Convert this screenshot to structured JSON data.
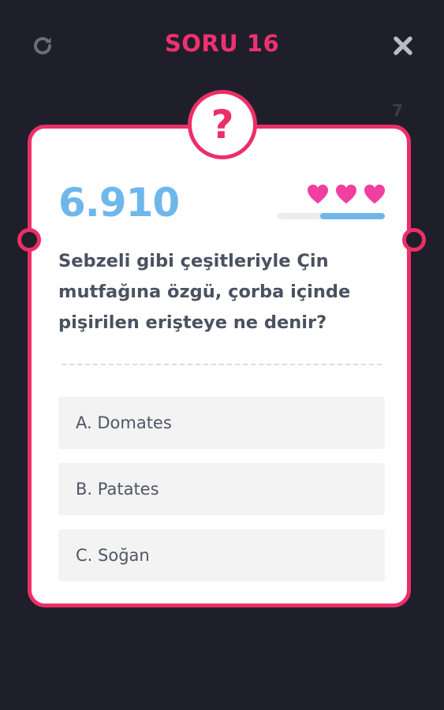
{
  "header": {
    "title": "SORU 16",
    "timer": "7"
  },
  "card": {
    "badge": "?",
    "score": "6.910",
    "lives": 3,
    "life_level_percent": 60,
    "question": "Sebzeli gibi çeşitleriyle Çin mutfağına özgü, çorba içinde pişirilen erişteye ne denir?",
    "options": [
      {
        "label": "A. Domates"
      },
      {
        "label": "B. Patates"
      },
      {
        "label": "C. Soğan"
      }
    ]
  },
  "colors": {
    "background": "#1f1f2b",
    "accent": "#ec2f67",
    "score": "#6fb7ea",
    "heart": "#f03fa0"
  },
  "icons": {
    "restart": "restart-icon",
    "close": "close-icon",
    "heart": "heart-icon",
    "question": "question-mark-icon"
  }
}
